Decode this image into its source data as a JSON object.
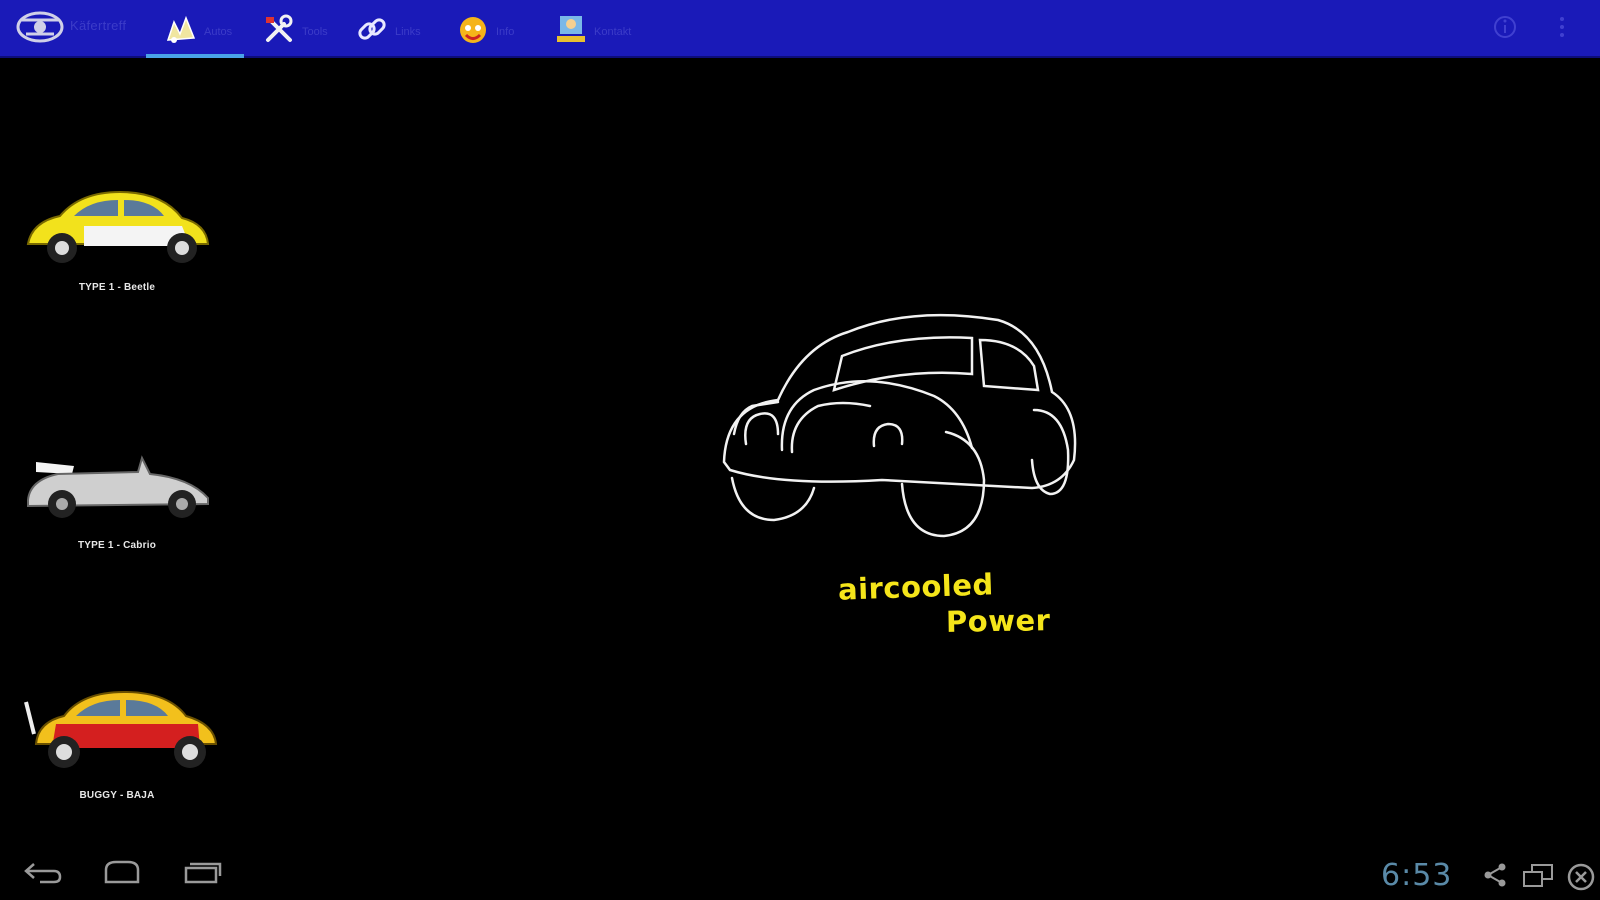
{
  "app": {
    "title": "Käfertreff",
    "tabs": [
      {
        "label": "Autos",
        "icon": "car-sketch-icon",
        "selected": true
      },
      {
        "label": "Tools",
        "icon": "tools-icon",
        "selected": false
      },
      {
        "label": "Links",
        "icon": "link-icon",
        "selected": false
      },
      {
        "label": "Info",
        "icon": "fun-icon",
        "selected": false
      },
      {
        "label": "Kontakt",
        "icon": "contact-icon",
        "selected": false
      }
    ],
    "colors": {
      "actionbar": "#1a1ab8",
      "tab_indicator": "#4aa3e8",
      "slogan": "#f5e51a",
      "background": "#000000"
    }
  },
  "cars": [
    {
      "caption": "TYPE 1 - Beetle",
      "icon": "yellow-beetle-icon"
    },
    {
      "caption": "TYPE 1 - Cabrio",
      "icon": "silver-cabrio-icon"
    },
    {
      "caption": "BUGGY - BAJA",
      "icon": "baja-bug-icon"
    }
  ],
  "hero": {
    "icon": "beetle-outline-icon",
    "slogan_line1": "aircooled",
    "slogan_line2": "Power"
  },
  "system_bar": {
    "time": "6:53",
    "buttons": [
      "back-icon",
      "home-icon",
      "recent-apps-icon"
    ],
    "status_icons": [
      "share-icon",
      "window-icon",
      "close-icon"
    ]
  }
}
